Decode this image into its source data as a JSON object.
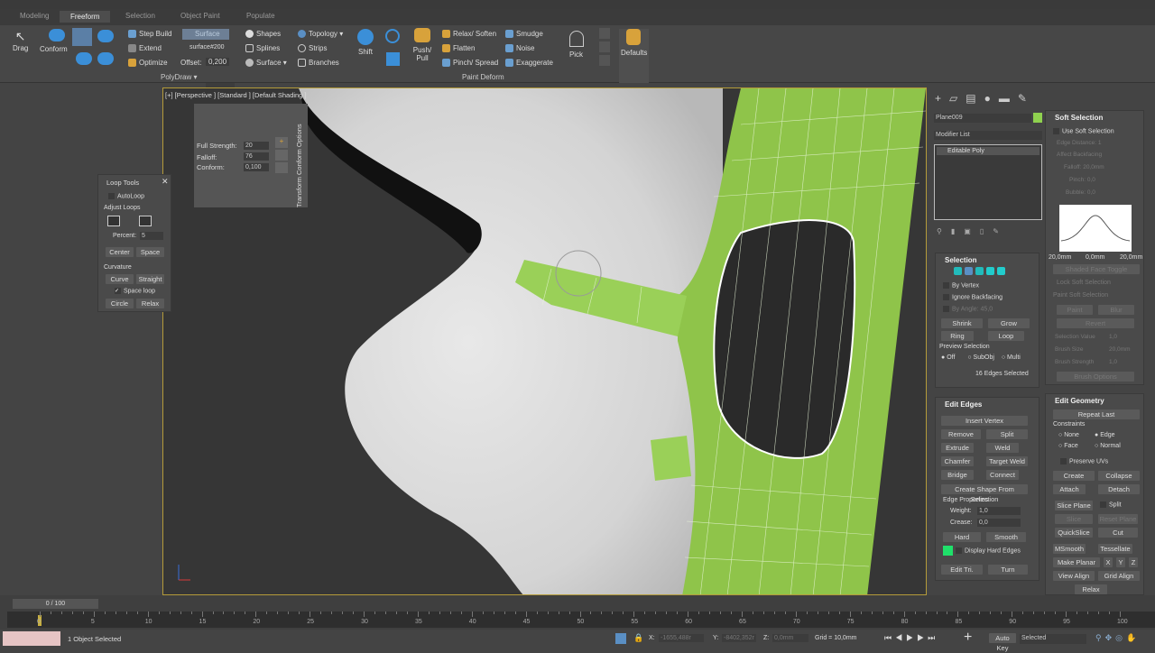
{
  "ribbon": {
    "tabs": [
      "Modeling",
      "Freeform",
      "Selection",
      "Object Paint",
      "Populate"
    ],
    "active_tab": "Freeform",
    "drag": "Drag",
    "conform": "Conform",
    "step_build": "Step Build",
    "extend": "Extend",
    "optimize": "Optimize",
    "surface_btn": "Surface",
    "surface_name": "surface#200",
    "offset_label": "Offset:",
    "offset_value": "0,200",
    "shapes": "Shapes",
    "splines": "Splines",
    "surface": "Surface",
    "topology": "Topology",
    "strips": "Strips",
    "branches": "Branches",
    "shift": "Shift",
    "push_pull": "Push/ Pull",
    "relax_soften": "Relax/ Soften",
    "flatten": "Flatten",
    "pinch_spread": "Pinch/ Spread",
    "smudge": "Smudge",
    "noise": "Noise",
    "exaggerate": "Exaggerate",
    "pick": "Pick",
    "defaults": "Defaults",
    "group_polydraw": "PolyDraw",
    "group_paint_deform": "Paint Deform"
  },
  "viewport": {
    "label": "[+] [Perspective ] [Standard ] [Default Shading ]"
  },
  "conform_options": {
    "title": "Transform Conform Options",
    "full_strength_label": "Full Strength:",
    "full_strength": "20",
    "falloff_label": "Falloff:",
    "falloff": "76",
    "conform_label": "Conform:",
    "conform": "0,100"
  },
  "loop_tools": {
    "title": "Loop Tools",
    "autoloop": "AutoLoop",
    "adjust_loops": "Adjust Loops",
    "percent_label": "Percent:",
    "percent": "5",
    "center": "Center",
    "space": "Space",
    "curvature": "Curvature",
    "curve": "Curve",
    "straight": "Straight",
    "space_loop": "Space loop",
    "circle": "Circle",
    "relax": "Relax"
  },
  "command_panel": {
    "object_name": "Plane009",
    "object_color": "#8fd14f",
    "modifier_list": "Modifier List",
    "stack_item": "Editable Poly",
    "selection": {
      "title": "Selection",
      "by_vertex": "By Vertex",
      "ignore_backfacing": "Ignore Backfacing",
      "by_angle": "By Angle:",
      "angle": "45,0",
      "shrink": "Shrink",
      "grow": "Grow",
      "ring": "Ring",
      "loop": "Loop",
      "preview": "Preview Selection",
      "off": "Off",
      "subobj": "SubObj",
      "multi": "Multi",
      "status": "16 Edges Selected"
    },
    "soft": {
      "title": "Soft Selection",
      "use": "Use Soft Selection",
      "edge_distance": "Edge Distance:",
      "edge_distance_value": "1",
      "affect_backfacing": "Affect Backfacing",
      "falloff": "Falloff:",
      "falloff_value": "20,0mm",
      "pinch": "Pinch:",
      "pinch_value": "0,0",
      "bubble": "Bubble:",
      "bubble_value": "0,0",
      "curve_left": "20,0mm",
      "curve_mid": "0,0mm",
      "curve_right": "20,0mm",
      "shaded_face_toggle": "Shaded Face Toggle",
      "lock": "Lock Soft Selection",
      "paint_group": "Paint Soft Selection",
      "paint": "Paint",
      "blur": "Blur",
      "revert": "Revert",
      "selection_value": "Selection Value",
      "selection_value_v": "1,0",
      "brush_size": "Brush Size",
      "brush_size_v": "20,0mm",
      "brush_strength": "Brush Strength",
      "brush_strength_v": "1,0",
      "brush_options": "Brush Options"
    },
    "edit_edges": {
      "title": "Edit Edges",
      "insert_vertex": "Insert Vertex",
      "remove": "Remove",
      "split": "Split",
      "extrude": "Extrude",
      "weld": "Weld",
      "chamfer": "Chamfer",
      "target_weld": "Target Weld",
      "bridge": "Bridge",
      "connect": "Connect",
      "create_shape": "Create Shape From Selection",
      "edge_properties": "Edge Properties",
      "weight_label": "Weight:",
      "weight": "1,0",
      "crease_label": "Crease:",
      "crease": "0,0",
      "hard": "Hard",
      "smooth": "Smooth",
      "display_hard_edges": "Display Hard Edges",
      "hard_edge_color": "#1fe06a",
      "edit_tri": "Edit Tri.",
      "turn": "Turn"
    },
    "edit_geometry": {
      "title": "Edit Geometry",
      "repeat_last": "Repeat Last",
      "constraints": "Constraints",
      "none": "None",
      "edge": "Edge",
      "face": "Face",
      "normal": "Normal",
      "preserve_uvs": "Preserve UVs",
      "create": "Create",
      "collapse": "Collapse",
      "attach": "Attach",
      "detach": "Detach",
      "slice_plane": "Slice Plane",
      "split": "Split",
      "slice": "Slice",
      "reset_plane": "Reset Plane",
      "quickslice": "QuickSlice",
      "cut": "Cut",
      "msmooth": "MSmooth",
      "tessellate": "Tessellate",
      "make_planar": "Make Planar",
      "x": "X",
      "y": "Y",
      "z": "Z",
      "view_align": "View Align",
      "grid_align": "Grid Align",
      "relax": "Relax"
    }
  },
  "timeline": {
    "frame": "0 / 100",
    "ticks": [
      "0",
      "5",
      "10",
      "15",
      "20",
      "25",
      "30",
      "35",
      "40",
      "45",
      "50",
      "55",
      "60",
      "65",
      "70",
      "75",
      "80",
      "85",
      "90",
      "95",
      "100"
    ],
    "current_frame": 0
  },
  "status": {
    "selection": "1 Object Selected",
    "x_label": "X:",
    "x": "-1655,488r",
    "y_label": "Y:",
    "y": "-8402,352r",
    "z_label": "Z:",
    "z": "0,0mm",
    "grid": "Grid = 10,0mm",
    "auto_key": "Auto Key",
    "key_mode": "Selected"
  }
}
